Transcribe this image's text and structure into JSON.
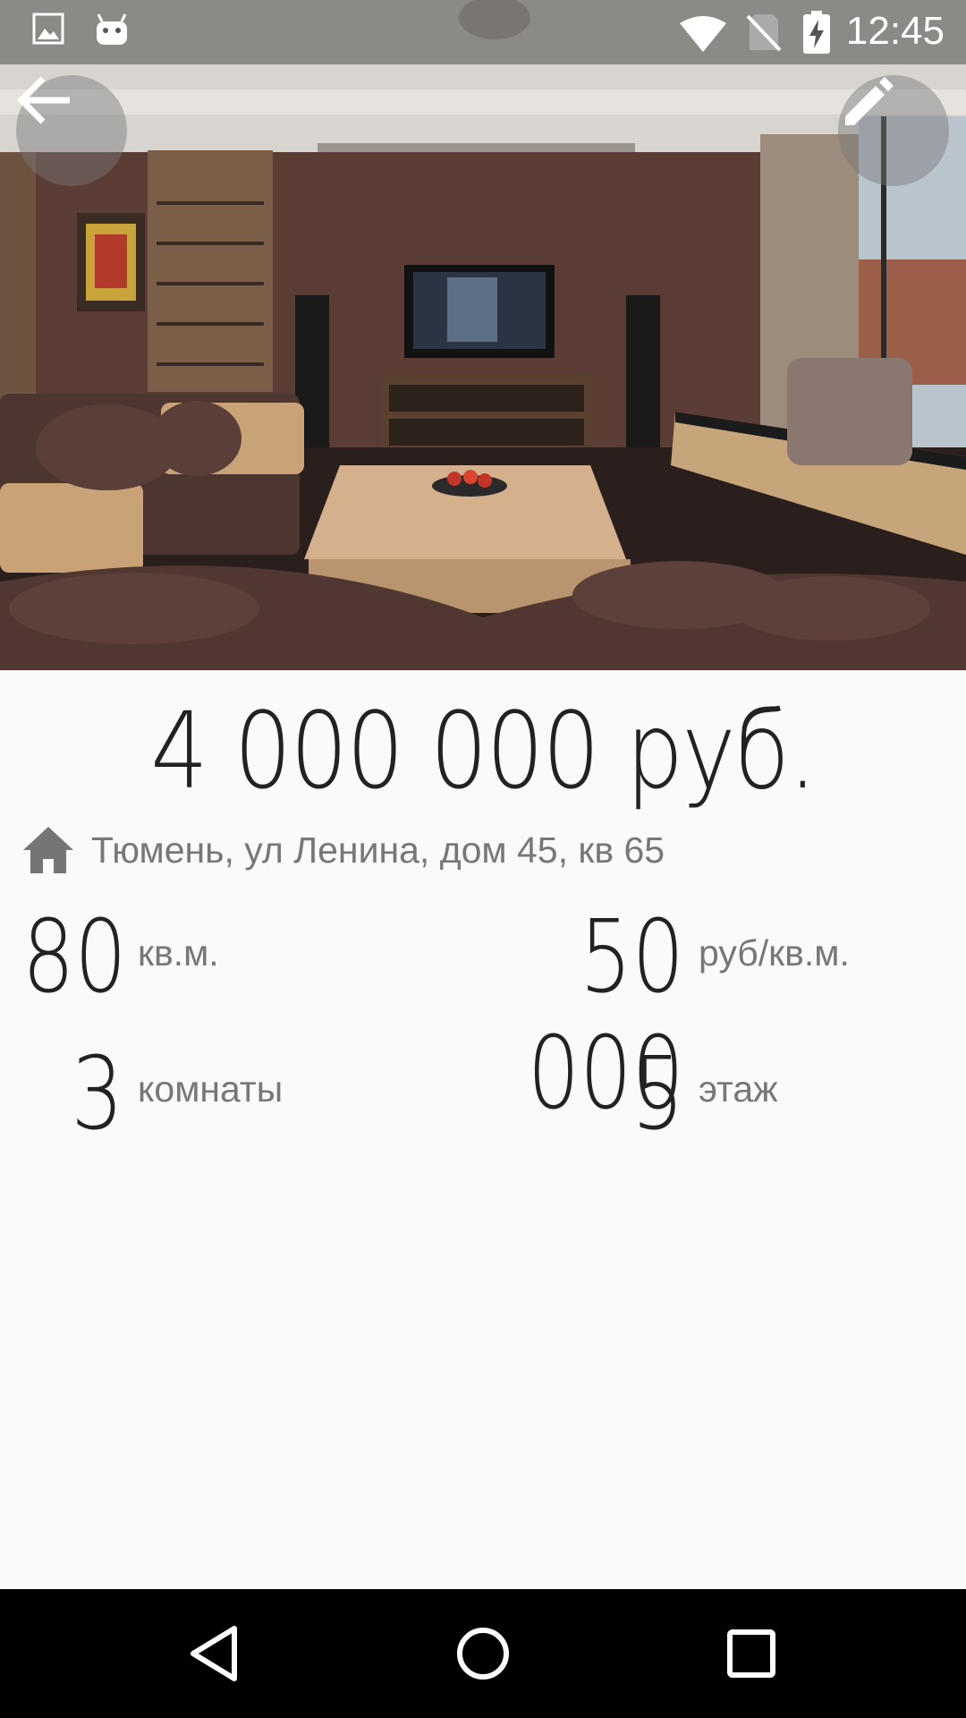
{
  "status_bar": {
    "time": "12:45",
    "icons": [
      "image-notification-icon",
      "android-notification-icon",
      "wifi-icon",
      "no-sim-icon",
      "battery-charging-icon"
    ]
  },
  "toolbar": {
    "back_icon": "arrow-back-icon",
    "edit_icon": "pencil-icon"
  },
  "listing": {
    "price": "4 000 000 руб.",
    "address": "Тюмень, ул Ленина, дом 45, кв 65",
    "area_value": "80",
    "area_unit": "кв.м.",
    "price_per_m2_value": "50 000",
    "price_per_m2_unit": "руб/кв.м.",
    "rooms_value": "3",
    "rooms_unit": "комнаты",
    "floor_value": "5",
    "floor_unit": "этаж"
  },
  "nav_bar": {
    "icons": [
      "nav-back-icon",
      "nav-home-icon",
      "nav-recents-icon"
    ]
  },
  "colors": {
    "text_primary": "#222222",
    "text_secondary": "#777777",
    "background": "#fafafa"
  }
}
